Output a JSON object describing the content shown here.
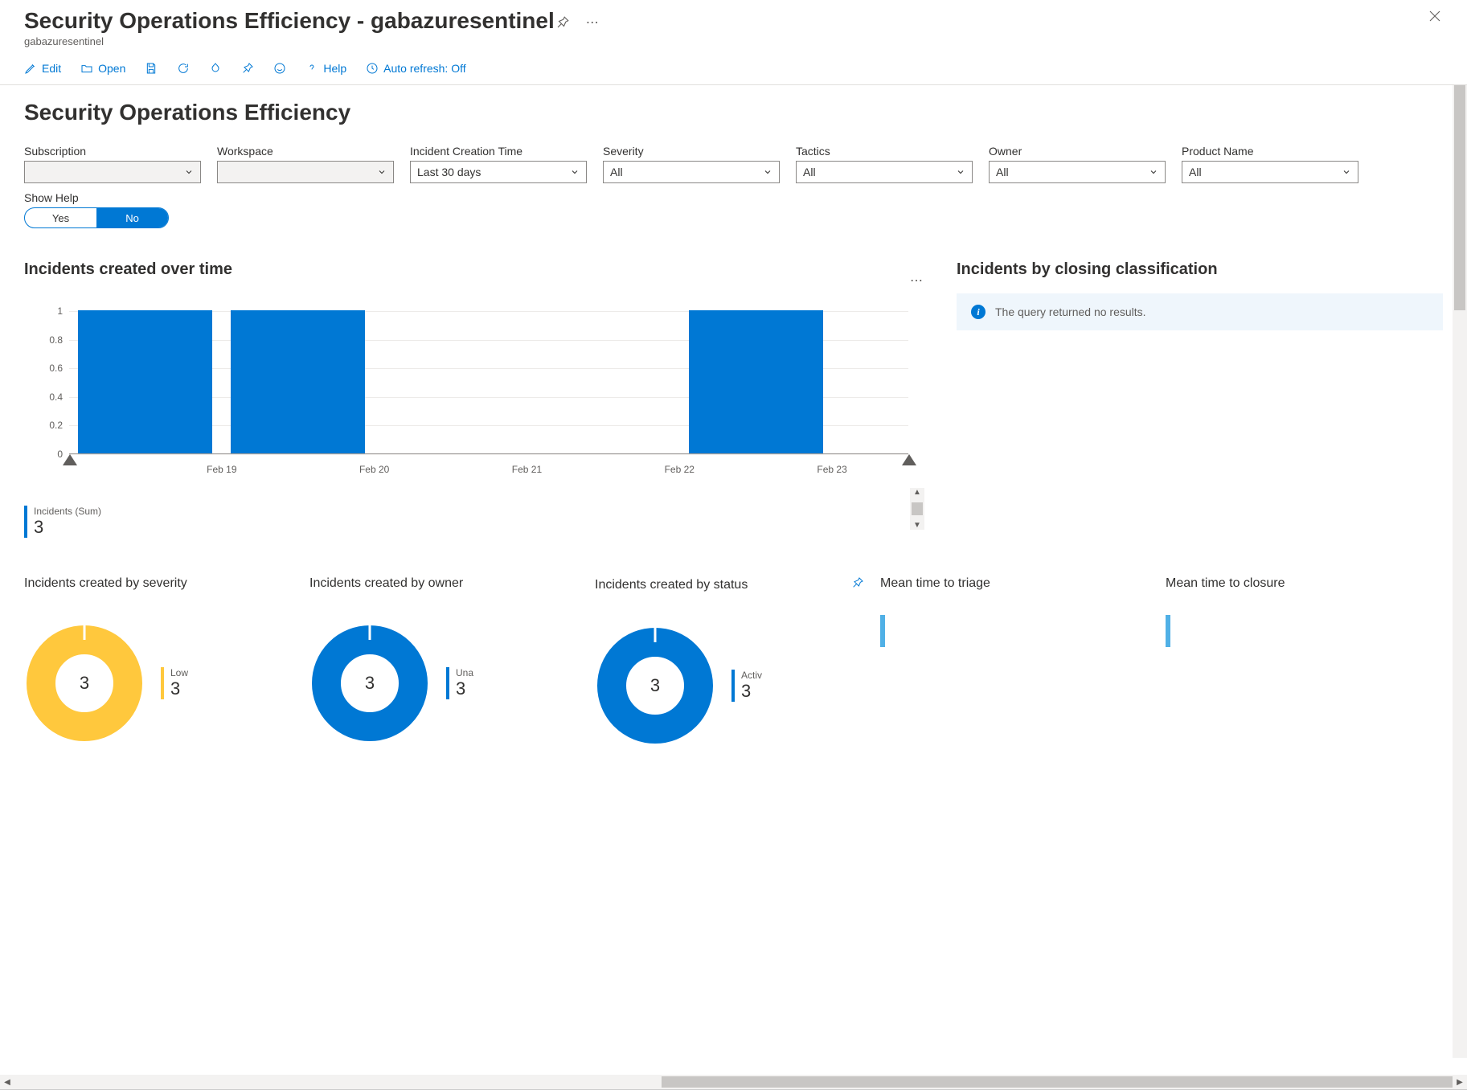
{
  "header": {
    "title": "Security Operations Efficiency - gabazuresentinel",
    "subtitle": "gabazuresentinel"
  },
  "toolbar": {
    "edit": "Edit",
    "open": "Open",
    "help": "Help",
    "auto_refresh": "Auto refresh: Off"
  },
  "main_title": "Security Operations Efficiency",
  "filters": {
    "subscription": {
      "label": "Subscription",
      "value": ""
    },
    "workspace": {
      "label": "Workspace",
      "value": ""
    },
    "incident_time": {
      "label": "Incident Creation Time",
      "value": "Last 30 days"
    },
    "severity": {
      "label": "Severity",
      "value": "All"
    },
    "tactics": {
      "label": "Tactics",
      "value": "All"
    },
    "owner": {
      "label": "Owner",
      "value": "All"
    },
    "product": {
      "label": "Product Name",
      "value": "All"
    },
    "show_help": {
      "label": "Show Help",
      "yes": "Yes",
      "no": "No"
    }
  },
  "sections": {
    "over_time": "Incidents created over time",
    "by_closing": "Incidents by closing classification",
    "no_results": "The query returned no results.",
    "legend_label": "Incidents (Sum)",
    "legend_value": "3"
  },
  "chart_data": {
    "type": "bar",
    "categories": [
      "Feb 19",
      "Feb 20",
      "Feb 21",
      "Feb 22",
      "Feb 23"
    ],
    "values": [
      1,
      1,
      0,
      0,
      1
    ],
    "title": "Incidents created over time",
    "xlabel": "",
    "ylabel": "",
    "ylim": [
      0,
      1
    ],
    "yticks": [
      0,
      0.2,
      0.4,
      0.6,
      0.8,
      1
    ]
  },
  "cards": {
    "severity": {
      "title": "Incidents created by severity",
      "center": "3",
      "legend_label": "Low",
      "legend_value": "3"
    },
    "owner": {
      "title": "Incidents created by owner",
      "center": "3",
      "legend_label": "Unassigned",
      "legend_value": "3"
    },
    "status": {
      "title": "Incidents created by status",
      "center": "3",
      "legend_label": "Active",
      "legend_value": "3"
    },
    "triage": {
      "title": "Mean time to triage"
    },
    "closure": {
      "title": "Mean time to closure"
    }
  },
  "colors": {
    "blue": "#0078d4",
    "yellow": "#ffc83d",
    "lightblue": "#50b0e6"
  }
}
